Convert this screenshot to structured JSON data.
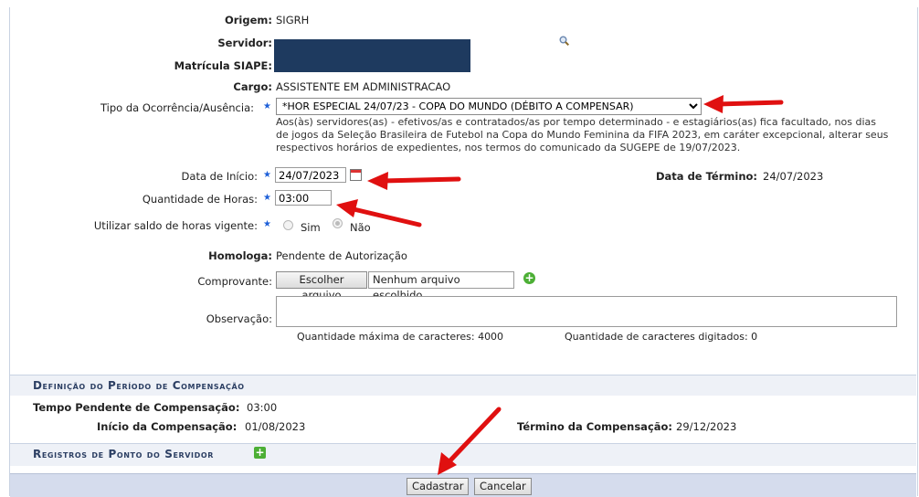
{
  "form": {
    "origem": {
      "label": "Origem:",
      "value": "SIGRH"
    },
    "servidor": {
      "label": "Servidor:"
    },
    "matricula": {
      "label": "Matrícula SIAPE:"
    },
    "cargo": {
      "label": "Cargo:",
      "value": "ASSISTENTE EM ADMINISTRACAO"
    },
    "tipo": {
      "label": "Tipo da Ocorrência/Ausência:",
      "selected": "*HOR ESPECIAL 24/07/23 - COPA DO MUNDO (DÉBITO A COMPENSAR)"
    },
    "note_lines": [
      "Aos(às) servidores(as) - efetivos/as e contratados/as por tempo determinado - e estagiários(as) fica facultado, nos dias",
      "de jogos da Seleção Brasileira de Futebol na Copa do Mundo Feminina da FIFA 2023, em caráter excepcional, alterar seus",
      "respectivos horários de expedientes, nos termos do comunicado da SUGEPE de 19/07/2023."
    ],
    "data_inicio": {
      "label": "Data de Início:",
      "value": "24/07/2023"
    },
    "data_termino": {
      "label": "Data de Término:",
      "value": "24/07/2023"
    },
    "horas": {
      "label": "Quantidade de Horas:",
      "value": "03:00"
    },
    "saldo": {
      "label": "Utilizar saldo de horas vigente:",
      "sim": "Sim",
      "nao": "Não"
    },
    "homologa": {
      "label": "Homologa:",
      "value": "Pendente de Autorização"
    },
    "comprovante": {
      "label": "Comprovante:",
      "button": "Escolher arquivo",
      "file": "Nenhum arquivo escolhido"
    },
    "observacao": {
      "label": "Observação:",
      "max": "Quantidade máxima de caracteres: 4000",
      "typed": "Quantidade de caracteres digitados: 0"
    }
  },
  "compensacao": {
    "title": "Definição do Período de Compensação",
    "tempo": {
      "label": "Tempo Pendente de Compensação:",
      "value": "03:00"
    },
    "inicio": {
      "label": "Início da Compensação:",
      "value": "01/08/2023"
    },
    "termino": {
      "label": "Término da Compensação:",
      "value": "29/12/2023"
    }
  },
  "registros": {
    "title": "Registros de Ponto do Servidor"
  },
  "actions": {
    "cadastrar": "Cadastrar",
    "cancelar": "Cancelar"
  },
  "colors": {
    "arrow": "#e01010",
    "section_bg": "#eef1f7",
    "footer_bg": "#d5dced"
  }
}
